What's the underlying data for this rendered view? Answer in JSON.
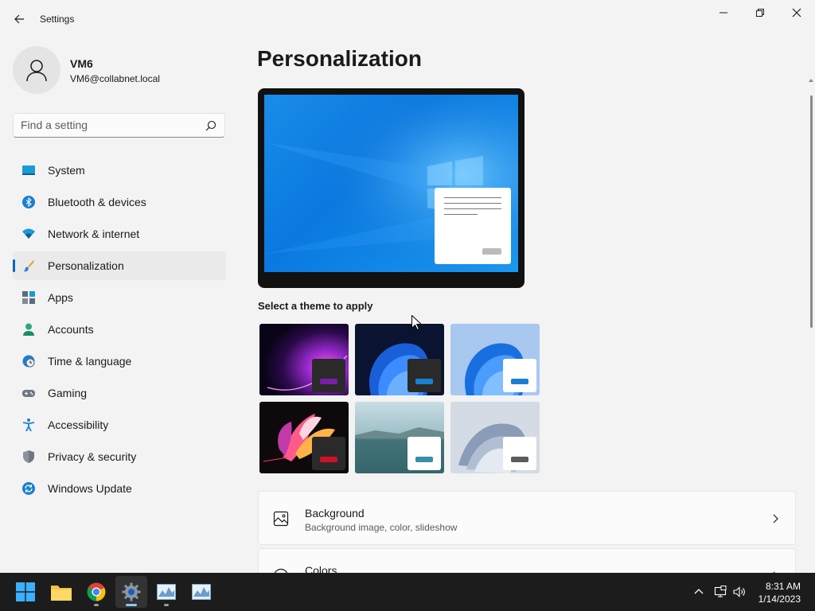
{
  "window": {
    "title": "Settings"
  },
  "profile": {
    "name": "VM6",
    "email": "VM6@collabnet.local"
  },
  "search": {
    "placeholder": "Find a setting"
  },
  "sidebar": {
    "items": [
      {
        "label": "System",
        "icon": "system-icon",
        "active": false
      },
      {
        "label": "Bluetooth & devices",
        "icon": "bluetooth-icon",
        "active": false
      },
      {
        "label": "Network & internet",
        "icon": "wifi-icon",
        "active": false
      },
      {
        "label": "Personalization",
        "icon": "brush-icon",
        "active": true
      },
      {
        "label": "Apps",
        "icon": "apps-icon",
        "active": false
      },
      {
        "label": "Accounts",
        "icon": "accounts-icon",
        "active": false
      },
      {
        "label": "Time & language",
        "icon": "globe-clock-icon",
        "active": false
      },
      {
        "label": "Gaming",
        "icon": "gamepad-icon",
        "active": false
      },
      {
        "label": "Accessibility",
        "icon": "accessibility-icon",
        "active": false
      },
      {
        "label": "Privacy & security",
        "icon": "shield-icon",
        "active": false
      },
      {
        "label": "Windows Update",
        "icon": "update-icon",
        "active": false
      }
    ]
  },
  "main": {
    "title": "Personalization",
    "themes_label": "Select a theme to apply",
    "themes": [
      {
        "name": "theme-glow",
        "accent": "#7a1ea8"
      },
      {
        "name": "theme-bloom-dark",
        "accent": "#1a7fd0"
      },
      {
        "name": "theme-bloom-light",
        "accent": "#1a7fd0"
      },
      {
        "name": "theme-captured-motion",
        "accent": "#d0102a"
      },
      {
        "name": "theme-sunrise-lake",
        "accent": "#3a8fa8"
      },
      {
        "name": "theme-flow",
        "accent": "#5c5c5c"
      }
    ],
    "cards": [
      {
        "title": "Background",
        "subtitle": "Background image, color, slideshow",
        "icon": "image-icon"
      },
      {
        "title": "Colors",
        "subtitle": "",
        "icon": "palette-icon"
      }
    ]
  },
  "taskbar": {
    "apps": [
      {
        "name": "start-button",
        "icon": "windows-logo-icon"
      },
      {
        "name": "file-explorer",
        "icon": "folder-icon"
      },
      {
        "name": "chrome",
        "icon": "chrome-icon"
      },
      {
        "name": "settings",
        "icon": "gear-icon",
        "active": true
      },
      {
        "name": "app-1",
        "icon": "chart-window-icon"
      },
      {
        "name": "app-2",
        "icon": "chart-window-icon"
      }
    ],
    "time": "8:31 AM",
    "date": "1/14/2023"
  },
  "colors": {
    "accent": "#0067c0",
    "background": "#f3f3f3",
    "taskbar": "#1c1c1c"
  }
}
